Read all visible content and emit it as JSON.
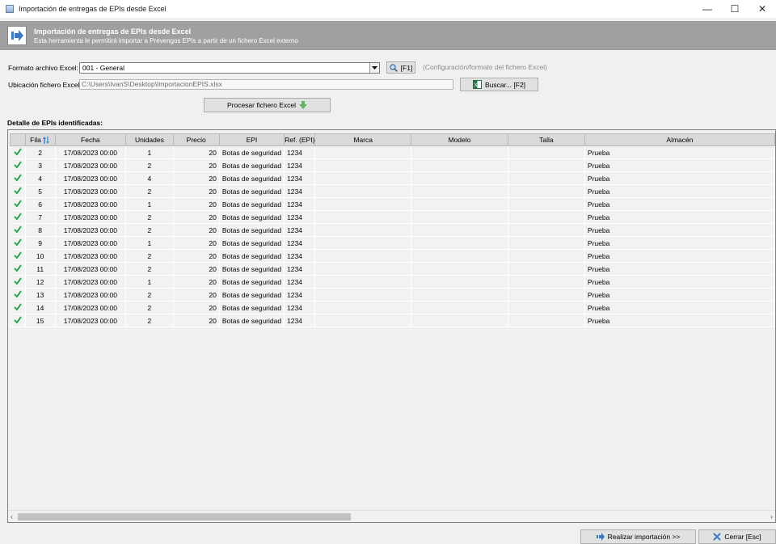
{
  "window": {
    "title": "Importación de entregas de EPIs desde Excel",
    "minimize": "—",
    "maximize": "☐",
    "close": "✕"
  },
  "banner": {
    "title": "Importación de entregas de EPIs desde Excel",
    "subtitle": "Esta herramienta le permitirá importar a Prevengos EPIs a partir de un fichero Excel externo",
    "icon": "arrow-right-icon"
  },
  "form": {
    "format_label": "Formato archivo Excel:",
    "format_value": "001 - General",
    "config_button": "[F1]",
    "config_hint": "(Configuración/formato del fichero Excel)",
    "location_label": "Ubicación fichero Excel:",
    "location_value": "C:\\Users\\IvanS\\Desktop\\ImportacionEPIS.xlsx",
    "browse_button": "Buscar...  [F2]",
    "process_button": "Procesar fichero Excel"
  },
  "section_title": "Detalle de EPIs identificadas:",
  "table": {
    "headers": [
      "",
      "Fila",
      "Fecha",
      "Unidades",
      "Precio",
      "EPI",
      "Ref. (EPI)",
      "Marca",
      "Modelo",
      "Talla",
      "Almacén"
    ],
    "rows": [
      {
        "fila": "2",
        "fecha": "17/08/2023  00:00",
        "unidades": "1",
        "precio": "20",
        "epi": "Botas de seguridad",
        "ref": "1234",
        "marca": "",
        "modelo": "",
        "talla": "",
        "almacen": "Prueba"
      },
      {
        "fila": "3",
        "fecha": "17/08/2023  00:00",
        "unidades": "2",
        "precio": "20",
        "epi": "Botas de seguridad",
        "ref": "1234",
        "marca": "",
        "modelo": "",
        "talla": "",
        "almacen": "Prueba"
      },
      {
        "fila": "4",
        "fecha": "17/08/2023  00:00",
        "unidades": "4",
        "precio": "20",
        "epi": "Botas de seguridad",
        "ref": "1234",
        "marca": "",
        "modelo": "",
        "talla": "",
        "almacen": "Prueba"
      },
      {
        "fila": "5",
        "fecha": "17/08/2023  00:00",
        "unidades": "2",
        "precio": "20",
        "epi": "Botas de seguridad",
        "ref": "1234",
        "marca": "",
        "modelo": "",
        "talla": "",
        "almacen": "Prueba"
      },
      {
        "fila": "6",
        "fecha": "17/08/2023  00:00",
        "unidades": "1",
        "precio": "20",
        "epi": "Botas de seguridad",
        "ref": "1234",
        "marca": "",
        "modelo": "",
        "talla": "",
        "almacen": "Prueba"
      },
      {
        "fila": "7",
        "fecha": "17/08/2023  00:00",
        "unidades": "2",
        "precio": "20",
        "epi": "Botas de seguridad",
        "ref": "1234",
        "marca": "",
        "modelo": "",
        "talla": "",
        "almacen": "Prueba"
      },
      {
        "fila": "8",
        "fecha": "17/08/2023  00:00",
        "unidades": "2",
        "precio": "20",
        "epi": "Botas de seguridad",
        "ref": "1234",
        "marca": "",
        "modelo": "",
        "talla": "",
        "almacen": "Prueba"
      },
      {
        "fila": "9",
        "fecha": "17/08/2023  00:00",
        "unidades": "1",
        "precio": "20",
        "epi": "Botas de seguridad",
        "ref": "1234",
        "marca": "",
        "modelo": "",
        "talla": "",
        "almacen": "Prueba"
      },
      {
        "fila": "10",
        "fecha": "17/08/2023  00:00",
        "unidades": "2",
        "precio": "20",
        "epi": "Botas de seguridad",
        "ref": "1234",
        "marca": "",
        "modelo": "",
        "talla": "",
        "almacen": "Prueba"
      },
      {
        "fila": "11",
        "fecha": "17/08/2023  00:00",
        "unidades": "2",
        "precio": "20",
        "epi": "Botas de seguridad",
        "ref": "1234",
        "marca": "",
        "modelo": "",
        "talla": "",
        "almacen": "Prueba"
      },
      {
        "fila": "12",
        "fecha": "17/08/2023  00:00",
        "unidades": "1",
        "precio": "20",
        "epi": "Botas de seguridad",
        "ref": "1234",
        "marca": "",
        "modelo": "",
        "talla": "",
        "almacen": "Prueba"
      },
      {
        "fila": "13",
        "fecha": "17/08/2023  00:00",
        "unidades": "2",
        "precio": "20",
        "epi": "Botas de seguridad",
        "ref": "1234",
        "marca": "",
        "modelo": "",
        "talla": "",
        "almacen": "Prueba"
      },
      {
        "fila": "14",
        "fecha": "17/08/2023  00:00",
        "unidades": "2",
        "precio": "20",
        "epi": "Botas de seguridad",
        "ref": "1234",
        "marca": "",
        "modelo": "",
        "talla": "",
        "almacen": "Prueba"
      },
      {
        "fila": "15",
        "fecha": "17/08/2023  00:00",
        "unidades": "2",
        "precio": "20",
        "epi": "Botas de seguridad",
        "ref": "1234",
        "marca": "",
        "modelo": "",
        "talla": "",
        "almacen": "Prueba"
      }
    ]
  },
  "footer": {
    "import_button": "Realizar importación >>",
    "close_button": "Cerrar  [Esc]"
  },
  "colors": {
    "banner": "#a0a0a0",
    "check": "#2fa84f",
    "process_arrow": "#5cb85c",
    "close_x": "#3a78c8"
  }
}
